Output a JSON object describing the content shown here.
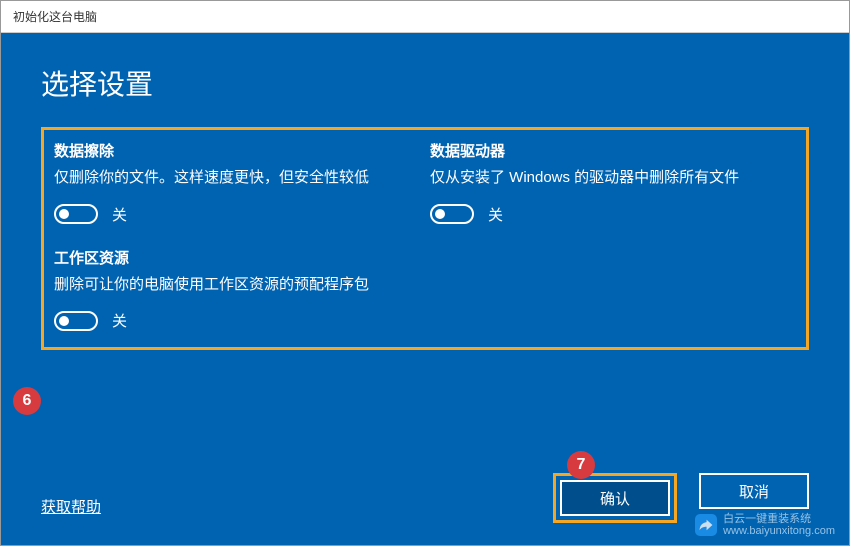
{
  "window": {
    "title": "初始化这台电脑"
  },
  "page": {
    "heading": "选择设置"
  },
  "options": {
    "dataErase": {
      "title": "数据擦除",
      "desc": "仅删除你的文件。这样速度更快，但安全性较低",
      "toggleState": "关"
    },
    "dataDrives": {
      "title": "数据驱动器",
      "desc": "仅从安装了 Windows 的驱动器中删除所有文件",
      "toggleState": "关"
    },
    "workspace": {
      "title": "工作区资源",
      "desc": "删除可让你的电脑使用工作区资源的预配程序包",
      "toggleState": "关"
    }
  },
  "footer": {
    "helpLink": "获取帮助",
    "confirm": "确认",
    "cancel": "取消"
  },
  "annotations": {
    "six": "6",
    "seven": "7"
  },
  "watermark": {
    "brand": "白云一键重装系统",
    "url": "www.baiyunxitong.com"
  }
}
